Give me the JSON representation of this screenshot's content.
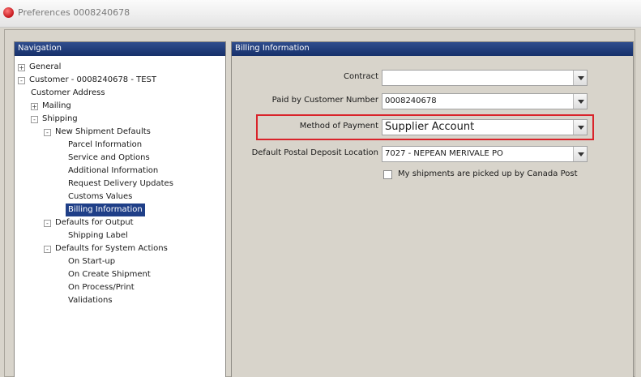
{
  "window": {
    "title": "Preferences 0008240678"
  },
  "navigation": {
    "header": "Navigation",
    "tree": [
      {
        "label": "General",
        "expander": "+"
      },
      {
        "label": "Customer - 0008240678 - TEST",
        "expander": "-"
      },
      {
        "label": "Customer Address"
      },
      {
        "label": "Mailing",
        "expander": "+"
      },
      {
        "label": "Shipping",
        "expander": "-"
      },
      {
        "label": "New Shipment Defaults",
        "expander": "-"
      },
      {
        "label": "Parcel Information"
      },
      {
        "label": "Service and Options"
      },
      {
        "label": "Additional Information"
      },
      {
        "label": "Request Delivery Updates"
      },
      {
        "label": "Customs Values"
      },
      {
        "label": "Billing Information",
        "selected": true
      },
      {
        "label": "Defaults for Output",
        "expander": "-"
      },
      {
        "label": "Shipping Label"
      },
      {
        "label": "Defaults for System Actions",
        "expander": "-"
      },
      {
        "label": "On Start-up"
      },
      {
        "label": "On Create Shipment"
      },
      {
        "label": "On Process/Print"
      },
      {
        "label": "Validations"
      }
    ]
  },
  "billing": {
    "header": "Billing Information",
    "contract_label": "Contract",
    "contract_value": "",
    "paid_by_label": "Paid by Customer Number",
    "paid_by_value": "0008240678",
    "method_label": "Method of Payment",
    "method_value": "Supplier Account",
    "deposit_label": "Default Postal Deposit Location",
    "deposit_value": "7027 - NEPEAN MERIVALE PO",
    "pickup_label": "My shipments are picked up by Canada Post",
    "pickup_checked": false
  },
  "colors": {
    "header_blue": "#1f3f88",
    "highlight_red": "#d9232a"
  }
}
